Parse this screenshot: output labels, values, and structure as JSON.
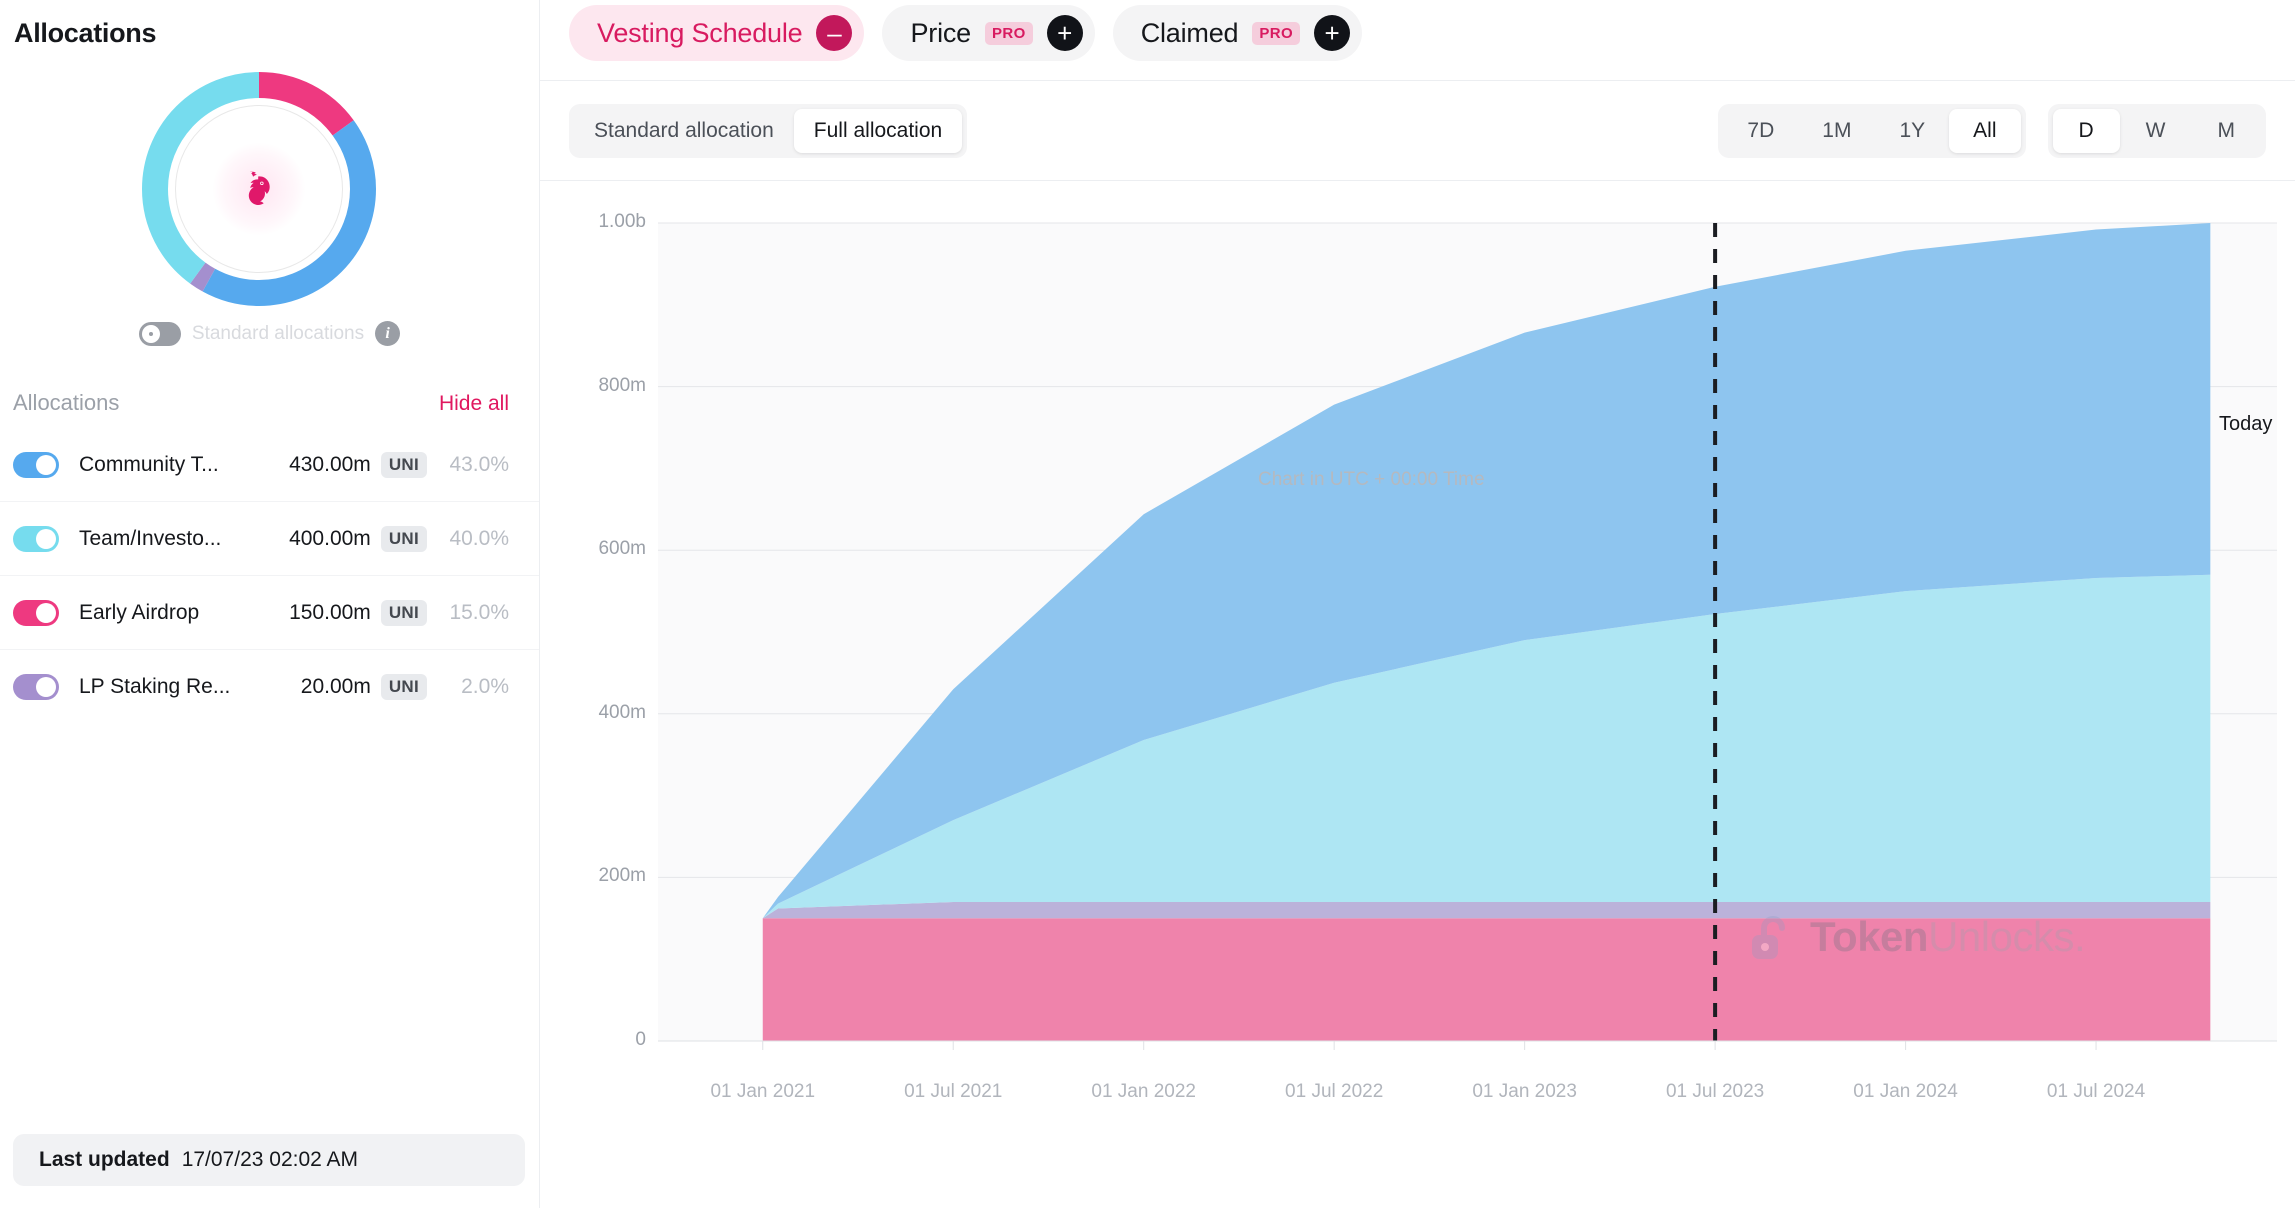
{
  "sidebar": {
    "title": "Allocations",
    "standard_toggle": {
      "label": "Standard allocations",
      "info_icon": "info-icon",
      "state": "off"
    },
    "list_header": {
      "title": "Allocations",
      "hide_all": "Hide all"
    },
    "allocations": [
      {
        "name": "Community T...",
        "amount": "430.00m",
        "symbol": "UNI",
        "percent": "43.0%",
        "color": "#56a9ee",
        "toggle": "on"
      },
      {
        "name": "Team/Investo...",
        "amount": "400.00m",
        "symbol": "UNI",
        "percent": "40.0%",
        "color": "#76dcee",
        "toggle": "on"
      },
      {
        "name": "Early Airdrop",
        "amount": "150.00m",
        "symbol": "UNI",
        "percent": "15.0%",
        "color": "#ee3980",
        "toggle": "on"
      },
      {
        "name": "LP Staking Re...",
        "amount": "20.00m",
        "symbol": "UNI",
        "percent": "2.0%",
        "color": "#a48fce",
        "toggle": "on"
      }
    ],
    "footer": {
      "label": "Last updated",
      "value": "17/07/23 02:02 AM"
    }
  },
  "header": {
    "chips": [
      {
        "label": "Vesting Schedule",
        "active": true,
        "badge": null,
        "button": "minus"
      },
      {
        "label": "Price",
        "active": false,
        "badge": "PRO",
        "button": "plus"
      },
      {
        "label": "Claimed",
        "active": false,
        "badge": "PRO",
        "button": "plus"
      }
    ]
  },
  "controls": {
    "allocation_modes": [
      {
        "label": "Standard allocation",
        "selected": false
      },
      {
        "label": "Full allocation",
        "selected": true
      }
    ],
    "ranges": [
      {
        "label": "7D",
        "selected": false
      },
      {
        "label": "1M",
        "selected": false
      },
      {
        "label": "1Y",
        "selected": false
      },
      {
        "label": "All",
        "selected": true
      }
    ],
    "granularity": [
      {
        "label": "D",
        "selected": true
      },
      {
        "label": "W",
        "selected": false
      },
      {
        "label": "M",
        "selected": false
      }
    ]
  },
  "chart_annotations": {
    "utc_note": "Chart in UTC + 00:00 Time",
    "today_label": "Today",
    "watermark_bold": "Token",
    "watermark_light": "Unlocks."
  },
  "chart_data": {
    "type": "area",
    "title": "Vesting Schedule",
    "xlabel": "",
    "ylabel": "",
    "ylim": [
      0,
      1000
    ],
    "yticks": [
      0,
      200,
      400,
      600,
      800,
      1000
    ],
    "ytick_labels": [
      "0",
      "200m",
      "400m",
      "600m",
      "800m",
      "1.00b"
    ],
    "grid": true,
    "legend": "none",
    "stacked": true,
    "x": [
      "01 Jan 2021",
      "01 Jul 2021",
      "01 Jan 2022",
      "01 Jul 2022",
      "01 Jan 2023",
      "01 Jul 2023",
      "01 Jan 2024",
      "01 Jul 2024"
    ],
    "xtick_labels": [
      "01 Jan 2021",
      "01 Jul 2021",
      "01 Jan 2022",
      "01 Jul 2022",
      "01 Jan 2023",
      "01 Jul 2023",
      "01 Jan 2024",
      "01 Jul 2024"
    ],
    "x_start": "01 Oct 2020",
    "x_end": "01 Nov 2024",
    "today_x": "01 Jul 2023",
    "series": [
      {
        "name": "Early Airdrop",
        "color": "#ef83ab",
        "x": [
          0,
          0.08,
          1,
          2,
          3,
          4,
          5,
          6,
          7,
          7.6
        ],
        "values": [
          150,
          150,
          150,
          150,
          150,
          150,
          150,
          150,
          150,
          150
        ]
      },
      {
        "name": "LP Staking Rewards",
        "color": "#bbb2da",
        "x": [
          0,
          0.08,
          1,
          2,
          3,
          4,
          5,
          6,
          7,
          7.6
        ],
        "values": [
          0,
          12,
          20,
          20,
          20,
          20,
          20,
          20,
          20,
          20
        ]
      },
      {
        "name": "Team/Investors",
        "color": "#aee6f3",
        "x": [
          0,
          0.08,
          1,
          2,
          3,
          4,
          5,
          6,
          7,
          7.6
        ],
        "values": [
          0,
          6,
          100,
          198,
          268,
          320,
          352,
          380,
          396,
          400
        ]
      },
      {
        "name": "Community Treasury",
        "color": "#8ec5ef",
        "x": [
          0,
          0.08,
          1,
          2,
          3,
          4,
          5,
          6,
          7,
          7.6
        ],
        "values": [
          0,
          8,
          160,
          276,
          340,
          376,
          400,
          416,
          426,
          430
        ]
      }
    ],
    "totals_note": "Stacked total approaches 1.00b"
  }
}
